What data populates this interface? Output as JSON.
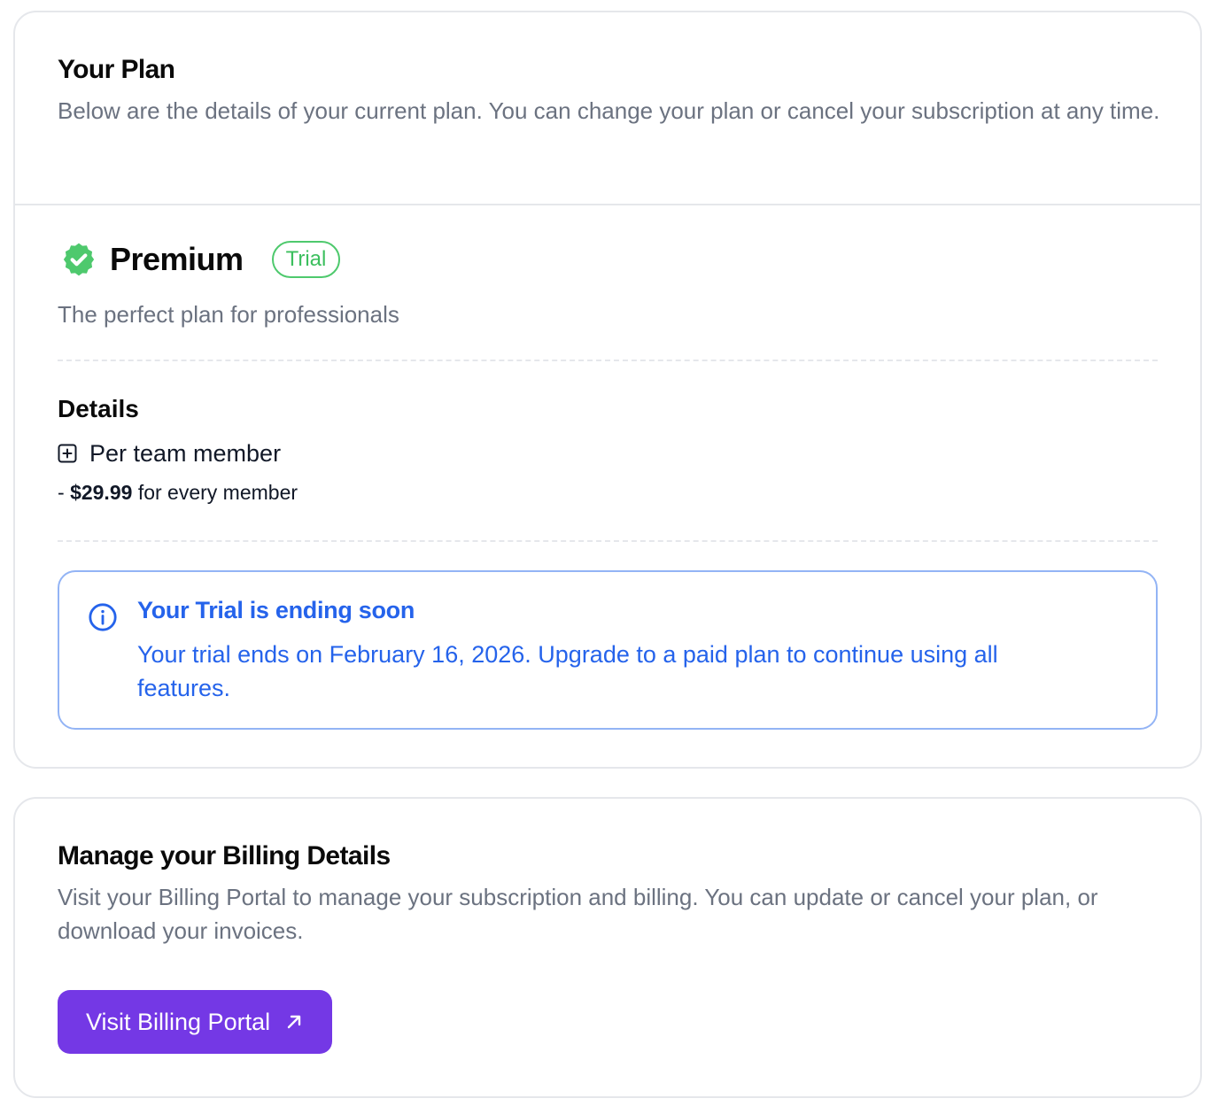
{
  "plan_card": {
    "title": "Your Plan",
    "description": "Below are the details of your current plan. You can change your plan or cancel your subscription at any time.",
    "plan": {
      "icon": "verified-badge-icon",
      "name": "Premium",
      "status_badge": "Trial",
      "subtitle": "The perfect plan for professionals"
    },
    "details": {
      "title": "Details",
      "item_icon": "plus-square-icon",
      "item_label": "Per team member",
      "price_prefix": "-",
      "price": "$29.99",
      "price_suffix": "for every member"
    },
    "alert": {
      "icon": "info-circle-icon",
      "title": "Your Trial is ending soon",
      "text": "Your trial ends on February 16, 2026. Upgrade to a paid plan to continue using all features."
    }
  },
  "billing_card": {
    "title": "Manage your Billing Details",
    "description": "Visit your Billing Portal to manage your subscription and billing. You can update or cancel your plan, or download your invoices.",
    "button_label": "Visit Billing Portal",
    "button_icon": "arrow-up-right-icon"
  },
  "colors": {
    "accent_purple": "#7438e5",
    "success_green": "#4ec96d",
    "info_blue": "#2563eb",
    "muted_text": "#6b7280",
    "border": "#e5e7eb"
  }
}
